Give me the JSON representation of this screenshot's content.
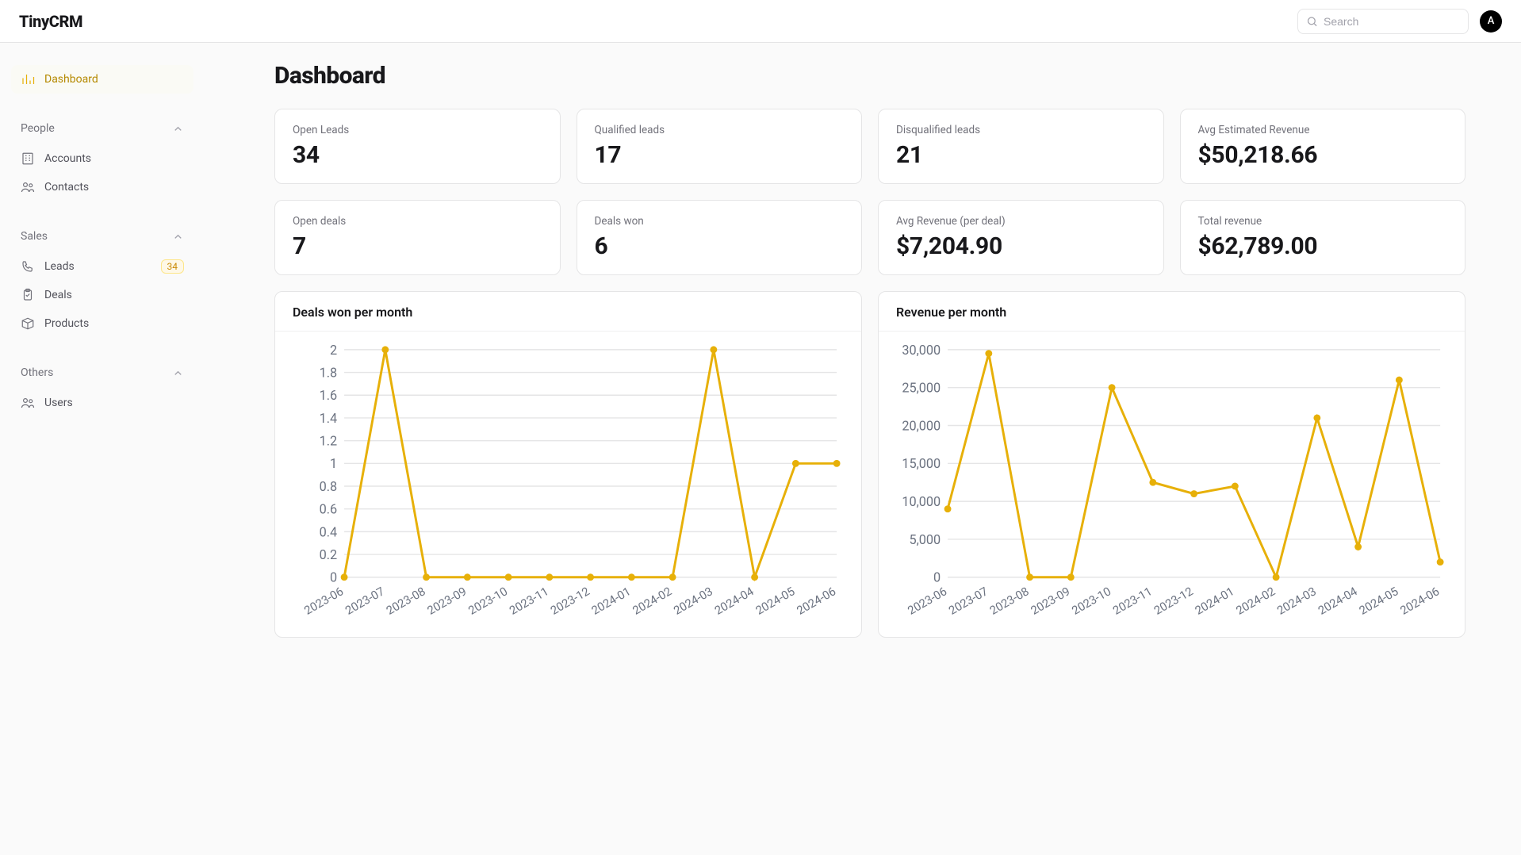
{
  "brand": "TinyCRM",
  "search": {
    "placeholder": "Search"
  },
  "avatar_initial": "A",
  "sidebar": {
    "dashboard": "Dashboard",
    "groups": [
      {
        "label": "People",
        "items": [
          {
            "icon": "building",
            "label": "Accounts"
          },
          {
            "icon": "users",
            "label": "Contacts"
          }
        ]
      },
      {
        "label": "Sales",
        "items": [
          {
            "icon": "phone",
            "label": "Leads",
            "badge": "34"
          },
          {
            "icon": "clipboard",
            "label": "Deals"
          },
          {
            "icon": "package",
            "label": "Products"
          }
        ]
      },
      {
        "label": "Others",
        "items": [
          {
            "icon": "users",
            "label": "Users"
          }
        ]
      }
    ]
  },
  "page_title": "Dashboard",
  "kpis": [
    {
      "label": "Open Leads",
      "value": "34"
    },
    {
      "label": "Qualified leads",
      "value": "17"
    },
    {
      "label": "Disqualified leads",
      "value": "21"
    },
    {
      "label": "Avg Estimated Revenue",
      "value": "$50,218.66"
    },
    {
      "label": "Open deals",
      "value": "7"
    },
    {
      "label": "Deals won",
      "value": "6"
    },
    {
      "label": "Avg Revenue (per deal)",
      "value": "$7,204.90"
    },
    {
      "label": "Total revenue",
      "value": "$62,789.00"
    }
  ],
  "chart_data": [
    {
      "type": "line",
      "title": "Deals won per month",
      "categories": [
        "2023-06",
        "2023-07",
        "2023-08",
        "2023-09",
        "2023-10",
        "2023-11",
        "2023-12",
        "2024-01",
        "2024-02",
        "2024-03",
        "2024-04",
        "2024-05",
        "2024-06"
      ],
      "values": [
        0,
        2,
        0,
        0,
        0,
        0,
        0,
        0,
        0,
        2,
        0,
        1,
        1
      ],
      "ylim": [
        0,
        2
      ],
      "yticks": [
        0,
        0.2,
        0.4,
        0.6,
        0.8,
        1.0,
        1.2,
        1.4,
        1.6,
        1.8,
        2.0
      ]
    },
    {
      "type": "line",
      "title": "Revenue per month",
      "categories": [
        "2023-06",
        "2023-07",
        "2023-08",
        "2023-09",
        "2023-10",
        "2023-11",
        "2023-12",
        "2024-01",
        "2024-02",
        "2024-03",
        "2024-04",
        "2024-05",
        "2024-06"
      ],
      "values": [
        9000,
        29500,
        0,
        0,
        25000,
        12500,
        11000,
        12000,
        0,
        21000,
        4000,
        26000,
        2000
      ],
      "ylim": [
        0,
        30000
      ],
      "yticks": [
        0,
        5000,
        10000,
        15000,
        20000,
        25000,
        30000
      ]
    }
  ]
}
